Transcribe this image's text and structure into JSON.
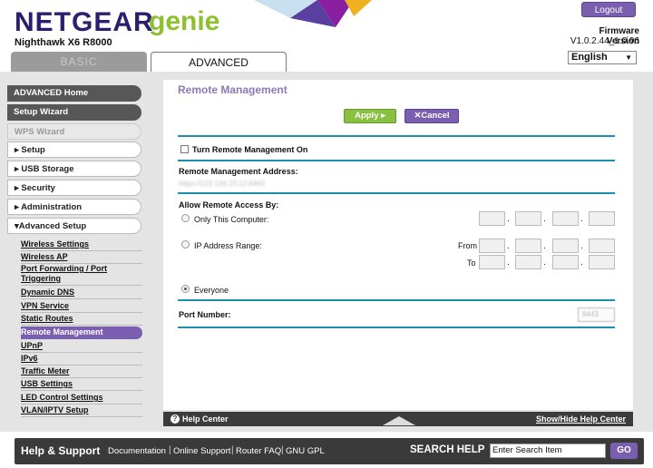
{
  "header": {
    "brand": "NETGEAR",
    "brand_suffix": "genie",
    "model": "Nighthawk X6 R8000",
    "logout": "Logout",
    "fw_label": "Firmware Version",
    "fw_version": "V1.0.2.44_1.0.96",
    "language": "English"
  },
  "tabs": {
    "basic": "BASIC",
    "advanced": "ADVANCED"
  },
  "sidebar": {
    "items": [
      "ADVANCED Home",
      "Setup Wizard",
      "WPS Wizard",
      "Setup",
      "USB Storage",
      "Security",
      "Administration",
      "Advanced Setup"
    ],
    "sub": [
      "Wireless Settings",
      "Wireless AP",
      "Port Forwarding / Port Triggering",
      "Dynamic DNS",
      "VPN Service",
      "Static Routes",
      "Remote Management",
      "UPnP",
      "IPv6",
      "Traffic Meter",
      "USB Settings",
      "LED Control Settings",
      "VLAN/IPTV Setup"
    ]
  },
  "main": {
    "title": "Remote Management",
    "apply": "Apply ▸",
    "cancel": "Cancel",
    "turn_on": "Turn Remote Management On",
    "address_label": "Remote Management Address:",
    "address_value": "https://123.134.23.12:8443",
    "allow_label": "Allow Remote Access By:",
    "only_this": "Only This Computer:",
    "ip_range": "IP Address Range:",
    "from": "From",
    "to": "To",
    "everyone": "Everyone",
    "port_label": "Port Number:",
    "port_value": "8443"
  },
  "help_center": {
    "label": "Help Center",
    "toggle": "Show/Hide Help Center"
  },
  "footer": {
    "title": "Help & Support",
    "links": [
      "Documentation",
      "Online Support",
      "Router FAQ",
      "GNU GPL"
    ],
    "search_label": "SEARCH HELP",
    "search_placeholder": "Enter Search Item",
    "go": "GO"
  },
  "colors": {
    "accent": "#7a5fb0",
    "green": "#88c040",
    "teal": "#1a8fb0"
  }
}
